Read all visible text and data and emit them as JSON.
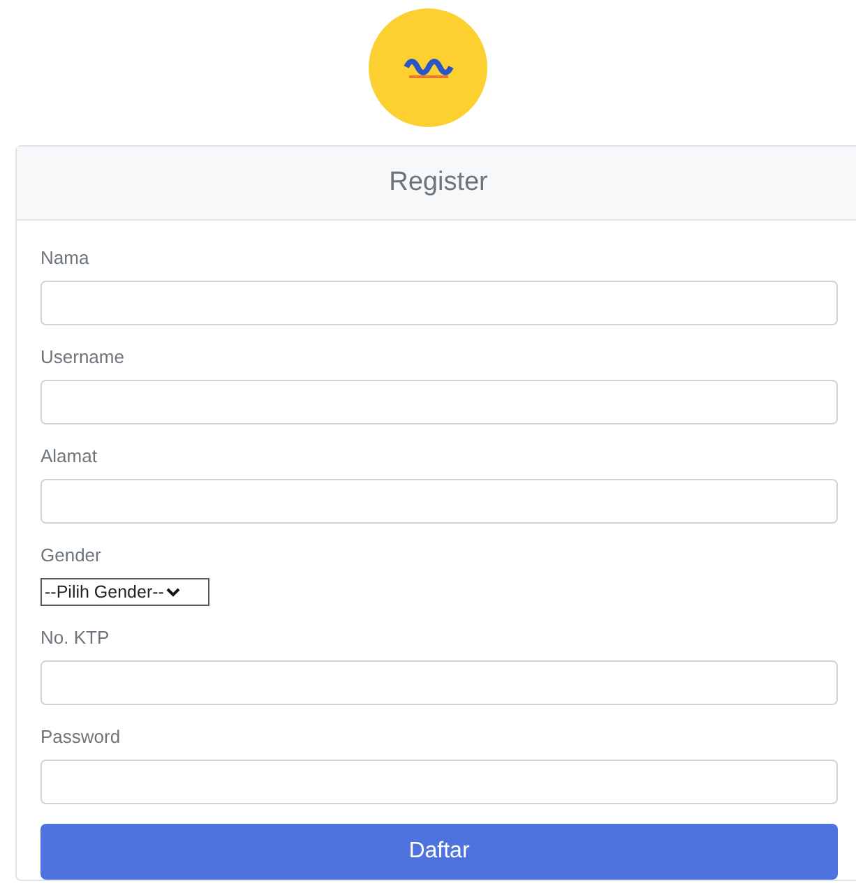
{
  "card": {
    "title": "Register"
  },
  "fields": [
    {
      "kind": "text",
      "label": "Nama"
    },
    {
      "kind": "text",
      "label": "Username"
    },
    {
      "kind": "text",
      "label": "Alamat"
    },
    {
      "kind": "select",
      "label": "Gender",
      "value": "--Pilih Gender--"
    },
    {
      "kind": "text",
      "label": "No. KTP"
    },
    {
      "kind": "password",
      "label": "Password"
    }
  ],
  "submit": "Daftar"
}
